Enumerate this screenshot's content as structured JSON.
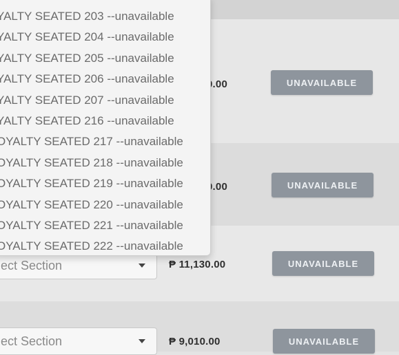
{
  "dropdown": {
    "options": [
      "YALTY SEATED 203 --unavailable",
      "YALTY SEATED 204 --unavailable",
      "YALTY SEATED 205 --unavailable",
      "YALTY SEATED 206 --unavailable",
      "YALTY SEATED 207 --unavailable",
      "YALTY SEATED 216 --unavailable",
      "OYALTY SEATED 217 --unavailable",
      "OYALTY SEATED 218 --unavailable",
      "OYALTY SEATED 219 --unavailable",
      "OYALTY SEATED 220 --unavailable",
      "OYALTY SEATED 221 --unavailable",
      "OYALTY SEATED 222 --unavailable"
    ]
  },
  "rows": [
    {
      "price": "0.00",
      "button": "UNAVAILABLE"
    },
    {
      "price": "0.00",
      "button": "UNAVAILABLE"
    },
    {
      "select": "ect Section",
      "price": "₱ 11,130.00",
      "button": "UNAVAILABLE"
    },
    {
      "select": "ect Section",
      "price": "₱ 9,010.00",
      "button": "UNAVAILABLE"
    }
  ],
  "icons": {
    "caret": "chevron-down-icon"
  },
  "colors": {
    "button_bg": "#8e959d",
    "button_text": "#eef1f4",
    "background": "#e4e4e4"
  }
}
